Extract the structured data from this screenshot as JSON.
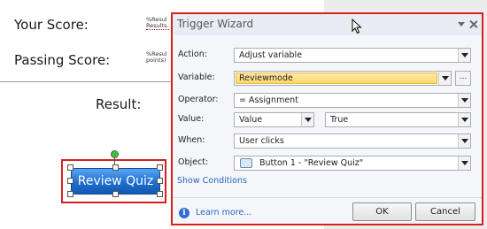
{
  "slide": {
    "your_score_label": "Your Score:",
    "passing_score_label": "Passing Score:",
    "result_label": "Result:",
    "score_var_1a": "%Resul",
    "score_var_1b": "Results.",
    "score_var_2a": "%Resul",
    "score_var_2b": "points)",
    "review_button_label": "Review Quiz"
  },
  "dialog": {
    "title": "Trigger Wizard",
    "fields": {
      "action_label": "Action:",
      "action_value": "Adjust variable",
      "variable_label": "Variable:",
      "variable_value": "Reviewmode",
      "variable_browse": "...",
      "operator_label": "Operator:",
      "operator_value": "= Assignment",
      "value_label": "Value:",
      "value_type": "Value",
      "value_value": "True",
      "when_label": "When:",
      "when_value": "User clicks",
      "object_label": "Object:",
      "object_value": "Button 1 - \"Review Quiz\""
    },
    "show_conditions": "Show Conditions",
    "learn_more": "Learn more...",
    "ok_label": "OK",
    "cancel_label": "Cancel"
  },
  "icons": {
    "info": "info-icon",
    "object": "button-object-icon",
    "cursor": "mouse-pointer-icon",
    "dropdown": "chevron-down-icon",
    "close": "close-icon"
  },
  "colors": {
    "highlight_border": "#d62020",
    "button_blue": "#1e6fd0",
    "link_blue": "#2a66c5",
    "variable_highlight": "#ffd86a"
  }
}
